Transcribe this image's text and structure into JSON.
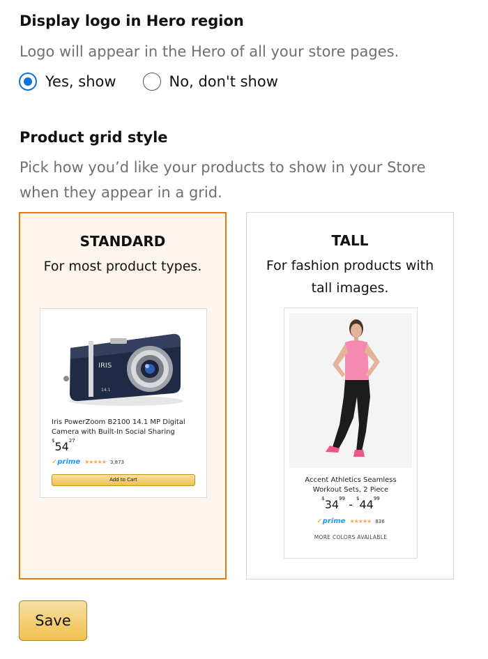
{
  "logo_section": {
    "title": "Display logo in Hero region",
    "description": "Logo will appear in the Hero of all your store pages.",
    "options": [
      {
        "label": "Yes, show",
        "checked": true
      },
      {
        "label": "No, don't show",
        "checked": false
      }
    ]
  },
  "grid_section": {
    "title": "Product grid style",
    "description_line1": "Pick how you’d like your products to show in your Store",
    "description_line2": "when they appear in a grid.",
    "cards": {
      "standard": {
        "title": "STANDARD",
        "description": "For most product types.",
        "selected": true,
        "product": {
          "title_line1": "Iris PowerZoom B2100 14.1 MP Digital",
          "title_line2": "Camera with Built-In Social Sharing",
          "currency": "$",
          "price_whole": "54",
          "price_fraction": "27",
          "prime_label": "prime",
          "rating_stars": "★★★★★",
          "review_count": "3,873",
          "button_label": "Add to Cart"
        }
      },
      "tall": {
        "title": "TALL",
        "description_line1": "For fashion products with",
        "description_line2": "tall images.",
        "selected": false,
        "product": {
          "title_line1": "Accent Athletics Seamless",
          "title_line2": "Workout Sets, 2 Piece",
          "currency": "$",
          "price_low_whole": "34",
          "price_low_fraction": "99",
          "price_separator": "-",
          "price_high_whole": "44",
          "price_high_fraction": "99",
          "prime_label": "prime",
          "rating_stars": "★★★★★",
          "review_count": "836",
          "more_colors": "MORE COLORS AVAILABLE"
        }
      }
    }
  },
  "save_label": "Save",
  "colors": {
    "selected_border": "#e47911",
    "selected_bg": "#fef4ee",
    "radio_accent": "#0b73d9",
    "button_gradient_top": "#f7dfa5",
    "button_gradient_bottom": "#f0c14b"
  }
}
